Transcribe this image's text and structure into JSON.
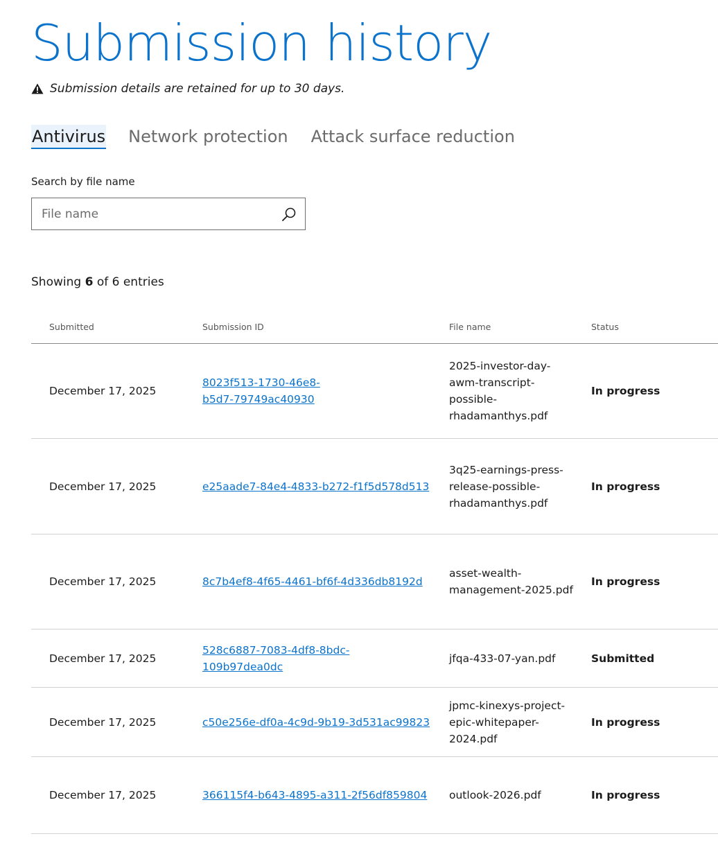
{
  "page": {
    "title": "Submission history",
    "notice": "Submission details are retained for up to 30 days."
  },
  "tabs": [
    {
      "label": "Antivirus",
      "active": true
    },
    {
      "label": "Network protection",
      "active": false
    },
    {
      "label": "Attack surface reduction",
      "active": false
    }
  ],
  "search": {
    "label": "Search by file name",
    "placeholder": "File name",
    "value": "",
    "icon": "search-icon"
  },
  "summary": {
    "prefix": "Showing",
    "shown": "6",
    "middle": "of 6 entries"
  },
  "table": {
    "headers": {
      "submitted": "Submitted",
      "submission_id": "Submission ID",
      "file_name": "File name",
      "status": "Status"
    },
    "rows": [
      {
        "submitted": "December 17, 2025",
        "id_line1": "8023f513-1730-46e8-",
        "id_line2": "b5d7-79749ac40930",
        "file_name": "2025-investor-day-awm-transcript-possible-rhadamanthys.pdf",
        "status": "In progress"
      },
      {
        "submitted": "December 17, 2025",
        "id_line1": "e25aade7-84e4-4833-b272-f1f5d578d513",
        "id_line2": "",
        "file_name": "3q25-earnings-press-release-possible-rhadamanthys.pdf",
        "status": "In progress"
      },
      {
        "submitted": "December 17, 2025",
        "id_line1": "8c7b4ef8-4f65-4461-bf6f-4d336db8192d",
        "id_line2": "",
        "file_name": "asset-wealth-management-2025.pdf",
        "status": "In progress"
      },
      {
        "submitted": "December 17, 2025",
        "id_line1": "528c6887-7083-4df8-8bdc-",
        "id_line2": "109b97dea0dc",
        "file_name": "jfqa-433-07-yan.pdf",
        "status": "Submitted"
      },
      {
        "submitted": "December 17, 2025",
        "id_line1": "c50e256e-df0a-4c9d-9b19-3d531ac99823",
        "id_line2": "",
        "file_name": "jpmc-kinexys-project-epic-whitepaper-2024.pdf",
        "status": "In progress"
      },
      {
        "submitted": "December 17, 2025",
        "id_line1": "366115f4-b643-4895-a311-2f56df859804",
        "id_line2": "",
        "file_name": "outlook-2026.pdf",
        "status": "In progress"
      }
    ]
  },
  "colors": {
    "accent": "#0c73cc",
    "text": "#1b1b1b",
    "muted": "#6b6b6b"
  }
}
